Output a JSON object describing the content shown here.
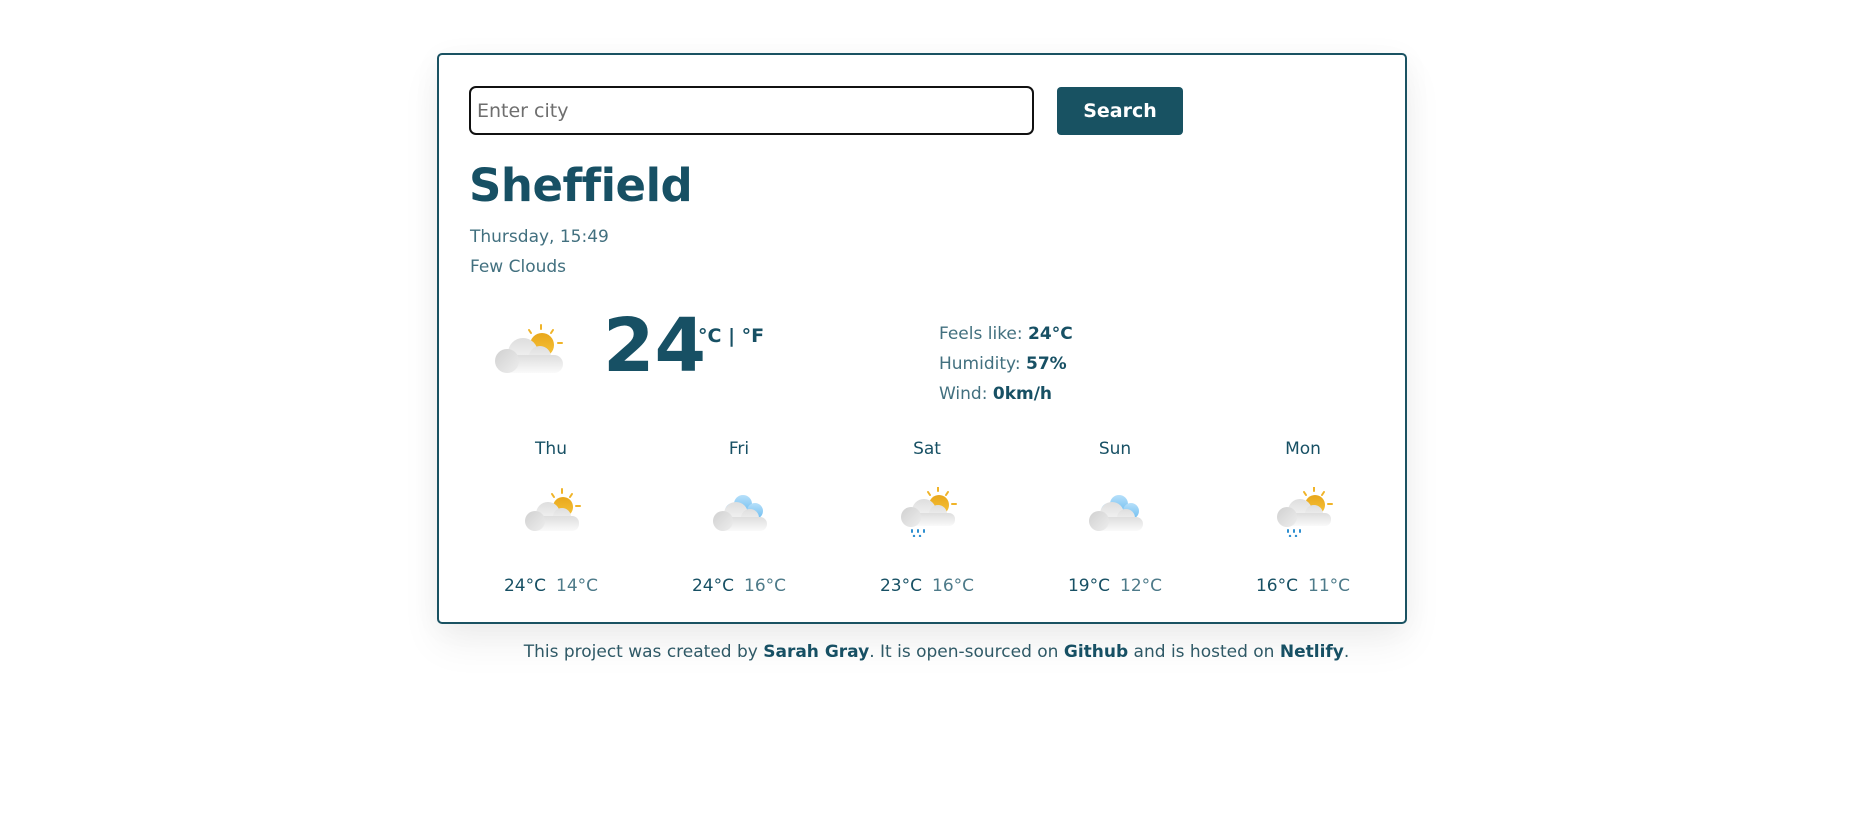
{
  "search": {
    "placeholder": "Enter city",
    "value": "",
    "button_label": "Search"
  },
  "current": {
    "city": "Sheffield",
    "datetime": "Thursday, 15:49",
    "description": "Few Clouds",
    "icon": "few-clouds-day-icon",
    "temperature": "24",
    "unit_celsius": "°C",
    "unit_separator": "|",
    "unit_fahrenheit": "°F",
    "details": [
      {
        "label": "Feels like: ",
        "value": "24°C"
      },
      {
        "label": "Humidity: ",
        "value": "57%"
      },
      {
        "label": "Wind: ",
        "value": "0km/h"
      }
    ]
  },
  "forecast": [
    {
      "day": "Thu",
      "icon": "few-clouds-day-icon",
      "max": "24°C",
      "min": "14°C"
    },
    {
      "day": "Fri",
      "icon": "broken-clouds-icon",
      "max": "24°C",
      "min": "16°C"
    },
    {
      "day": "Sat",
      "icon": "rain-day-icon",
      "max": "23°C",
      "min": "16°C"
    },
    {
      "day": "Sun",
      "icon": "broken-clouds-icon",
      "max": "19°C",
      "min": "12°C"
    },
    {
      "day": "Mon",
      "icon": "rain-day-icon",
      "max": "16°C",
      "min": "11°C"
    }
  ],
  "footer": {
    "text1": "This project was created by ",
    "author": "Sarah Gray",
    "text2": ". It is open-sourced on ",
    "github": "Github",
    "text3": " and is hosted on ",
    "netlify": "Netlify",
    "text4": "."
  },
  "colors": {
    "brand": "#185262",
    "sun": "#f0b429",
    "rain": "#2f8fd0",
    "cloud_blue": "#7cc4f2"
  }
}
